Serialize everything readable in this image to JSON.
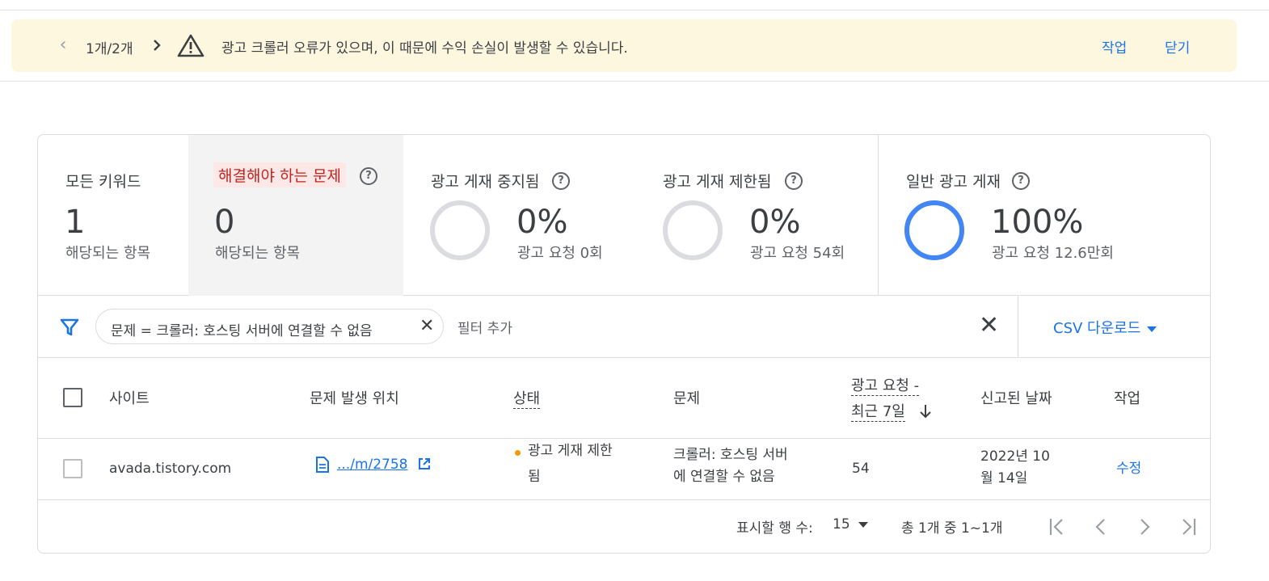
{
  "banner": {
    "counter": "1개/2개",
    "message": "광고 크롤러 오류가 있으며, 이 때문에 수익 손실이 발생할 수 있습니다.",
    "action_label": "작업",
    "close_label": "닫기",
    "bg_color": "#fef7e0"
  },
  "stats": [
    {
      "label": "모든 키워드",
      "value": "1",
      "sub": "해당되는 항목"
    },
    {
      "label": "해결해야 하는 문제",
      "value": "0",
      "sub": "해당되는 항목"
    },
    {
      "label": "광고 게재 중지됨",
      "value": "0%",
      "sub": "광고 요청 0회",
      "fill": 0
    },
    {
      "label": "광고 게재 제한됨",
      "value": "0%",
      "sub": "광고 요청 54회",
      "fill": 0
    },
    {
      "label": "일반 광고 게재",
      "value": "100%",
      "sub": "광고 요청 12.6만회",
      "fill": 1
    }
  ],
  "filter": {
    "chip": "문제 = 크롤러: 호스팅 서버에 연결할 수 없음",
    "add_placeholder": "필터 추가",
    "csv_label": "CSV 다운로드"
  },
  "table": {
    "headers": {
      "site": "사이트",
      "location": "문제 발생 위치",
      "status": "상태",
      "issue": "문제",
      "requests_line1": "광고 요청 -",
      "requests_line2": "최근 7일",
      "reported": "신고된 날짜",
      "action": "작업"
    },
    "rows": [
      {
        "site": "avada.tistory.com",
        "location": ".../m/2758",
        "status_line1": "광고 게재 제한",
        "status_line2": "됨",
        "issue_line1": "크롤러: 호스팅 서버",
        "issue_line2": "에 연결할 수 없음",
        "requests": "54",
        "date_line1": "2022년 10",
        "date_line2": "월 14일",
        "action": "수정"
      }
    ]
  },
  "pagination": {
    "rows_label": "표시할 행 수:",
    "rows_value": "15",
    "range": "총 1개 중 1~1개"
  },
  "colors": {
    "accent": "#1a73e8",
    "error": "#c5221f",
    "ring_empty": "#dadce0",
    "ring_full": "#4285f4",
    "status_dot": "#f29900"
  }
}
